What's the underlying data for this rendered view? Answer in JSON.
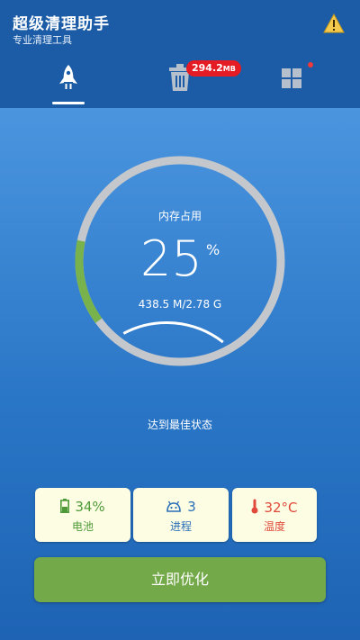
{
  "header": {
    "title": "超级清理助手",
    "subtitle": "专业清理工具",
    "clean_badge": {
      "value": "294.2",
      "unit": "MB"
    }
  },
  "memory": {
    "label": "内存占用",
    "percent": "25",
    "percent_sign": "%",
    "percent_value": 25,
    "detail": "438.5 M/2.78 G"
  },
  "status": "达到最佳状态",
  "cards": {
    "battery": {
      "value": "34%",
      "label": "电池"
    },
    "process": {
      "value": "3",
      "label": "进程"
    },
    "temperature": {
      "value": "32°C",
      "label": "温度"
    }
  },
  "optimize_button": "立即优化",
  "colors": {
    "header_bg": "#1c5ca6",
    "badge": "#e51c23",
    "gauge_track": "#c4c8cc",
    "gauge_fill": "#77b24c",
    "card_bg": "#fdfde4",
    "battery_text": "#4f9a38",
    "process_text": "#2a6fb8",
    "temp_text": "#e04a3b",
    "button_bg": "#74a949"
  }
}
